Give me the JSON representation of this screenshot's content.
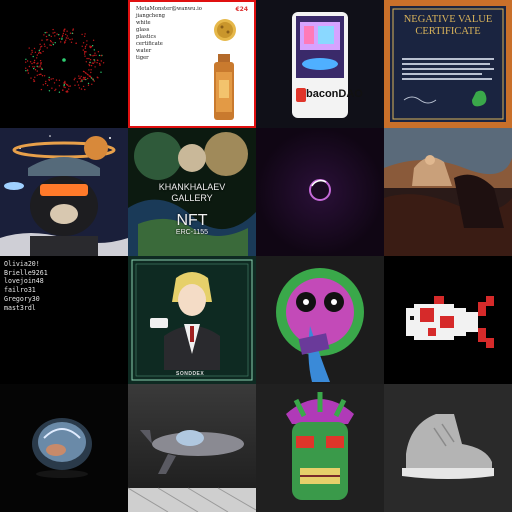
{
  "gallery": {
    "tiles": [
      {
        "name": "dark-particle-sphere"
      },
      {
        "name": "metamonster-bottle",
        "lines": [
          "MetaMonster@wanwu.io",
          "jiangcheng",
          "white",
          "glass",
          "plastics",
          "certificate",
          "water",
          "tiger"
        ],
        "price": "€24"
      },
      {
        "name": "bacondao-card",
        "brand": "baconDAO"
      },
      {
        "name": "negative-value-certificate",
        "title": "NEGATIVE VALUE CERTIFICATE"
      },
      {
        "name": "bear-astronaut"
      },
      {
        "name": "khankhalaev-gallery",
        "line1": "KHANKHALAEV",
        "line2": "GALLERY",
        "line3": "NFT",
        "line4": "ERC-1155"
      },
      {
        "name": "purple-orb"
      },
      {
        "name": "rider-painting"
      },
      {
        "name": "username-list",
        "users": [
          "Olivia20!",
          "Brielle9261",
          "lovejoin48",
          "failro31",
          "Gregory30",
          "mast3rdl"
        ]
      },
      {
        "name": "anime-waiter-card",
        "brand": "SONDDEX"
      },
      {
        "name": "tongue-monster"
      },
      {
        "name": "pixel-koi"
      },
      {
        "name": "glass-helmet"
      },
      {
        "name": "rocket-car"
      },
      {
        "name": "tiki-mask"
      },
      {
        "name": "grey-sneaker"
      }
    ],
    "colors": {
      "selected_border": "#e01010",
      "background": "#000000"
    }
  }
}
